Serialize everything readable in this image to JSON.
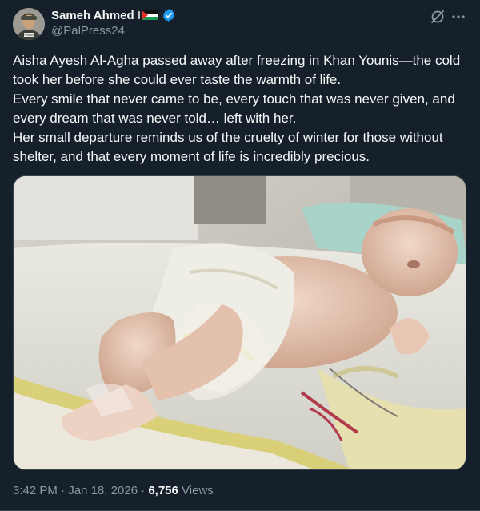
{
  "author": {
    "display_name": "Sameh Ahmed",
    "handle": "@PalPress24",
    "avatar_icon": "press-photographer-avatar",
    "flag_icon": "palestine-flag-icon",
    "verified_icon": "verified-badge-icon"
  },
  "tweet": {
    "lines": [
      "Aisha Ayesh Al-Agha passed away after freezing in Khan Younis—the cold took her before she could ever taste the warmth of life.",
      "Every smile that never came to be, every touch that was never given, and every dream that was never told… left with her.",
      "Her small departure reminds us of the cruelty of winter for those without shelter, and that every moment of life is incredibly precious."
    ],
    "time": "3:42 PM",
    "separator": "·",
    "date": "Jan 18, 2026",
    "views_count": "6,756",
    "views_label": "Views"
  },
  "actions": {
    "grok_icon": "grok-icon",
    "more_icon": "more-dots-icon"
  },
  "colors": {
    "background": "#15202b",
    "text": "#f7f9f9",
    "secondary_text": "#8b98a5",
    "verified_blue": "#1d9bf0",
    "border": "#38444d"
  }
}
